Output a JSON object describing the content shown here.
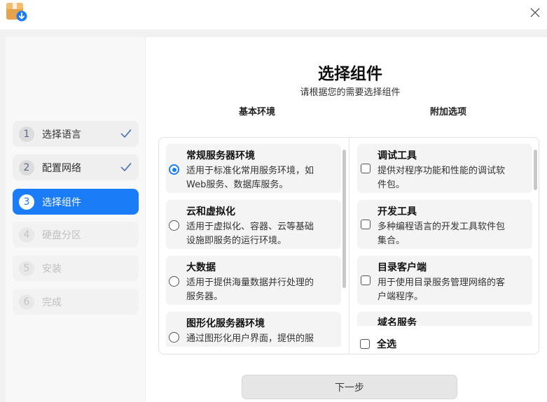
{
  "window": {
    "app_icon": "package-installer-icon",
    "close_icon": "close-icon"
  },
  "steps": [
    {
      "num": "1",
      "label": "选择语言",
      "state": "done"
    },
    {
      "num": "2",
      "label": "配置网络",
      "state": "done"
    },
    {
      "num": "3",
      "label": "选择组件",
      "state": "active"
    },
    {
      "num": "4",
      "label": "硬盘分区",
      "state": "pending"
    },
    {
      "num": "5",
      "label": "安装",
      "state": "pending"
    },
    {
      "num": "6",
      "label": "完成",
      "state": "pending"
    }
  ],
  "main": {
    "title": "选择组件",
    "subtitle": "请根据您的需要选择组件",
    "base_env_header": "基本环境",
    "addons_header": "附加选项"
  },
  "base_environments": [
    {
      "title": "常规服务器环境",
      "desc1": "适用于标准化常用服务环境，如",
      "desc2": "Web服务、数据库服务。",
      "selected": true
    },
    {
      "title": "云和虚拟化",
      "desc1": "适用于虚拟化、容器、云等基础",
      "desc2": "设施即服务的运行环境。",
      "selected": false
    },
    {
      "title": "大数据",
      "desc1": "适用于提供海量数据并行处理的",
      "desc2": "服务器。",
      "selected": false
    },
    {
      "title": "图形化服务器环境",
      "desc1": "通过图形化用户界面，提供的服",
      "desc2": "",
      "selected": false
    }
  ],
  "addons": [
    {
      "title": "调试工具",
      "desc1": "提供对程序功能和性能的调试软",
      "desc2": "件包。",
      "checked": false
    },
    {
      "title": "开发工具",
      "desc1": "多种编程语言的开发工具软件包",
      "desc2": "集合。",
      "checked": false
    },
    {
      "title": "目录客户端",
      "desc1": "用于使用目录服务管理网络的客",
      "desc2": "户端程序。",
      "checked": false
    },
    {
      "title": "域名服务",
      "desc1": "",
      "desc2": "",
      "checked": false
    }
  ],
  "select_all": {
    "label": "全选",
    "checked": false
  },
  "next_button": {
    "label": "下一步"
  },
  "colors": {
    "accent": "#1a7cf7",
    "check": "#5a7bb5"
  }
}
